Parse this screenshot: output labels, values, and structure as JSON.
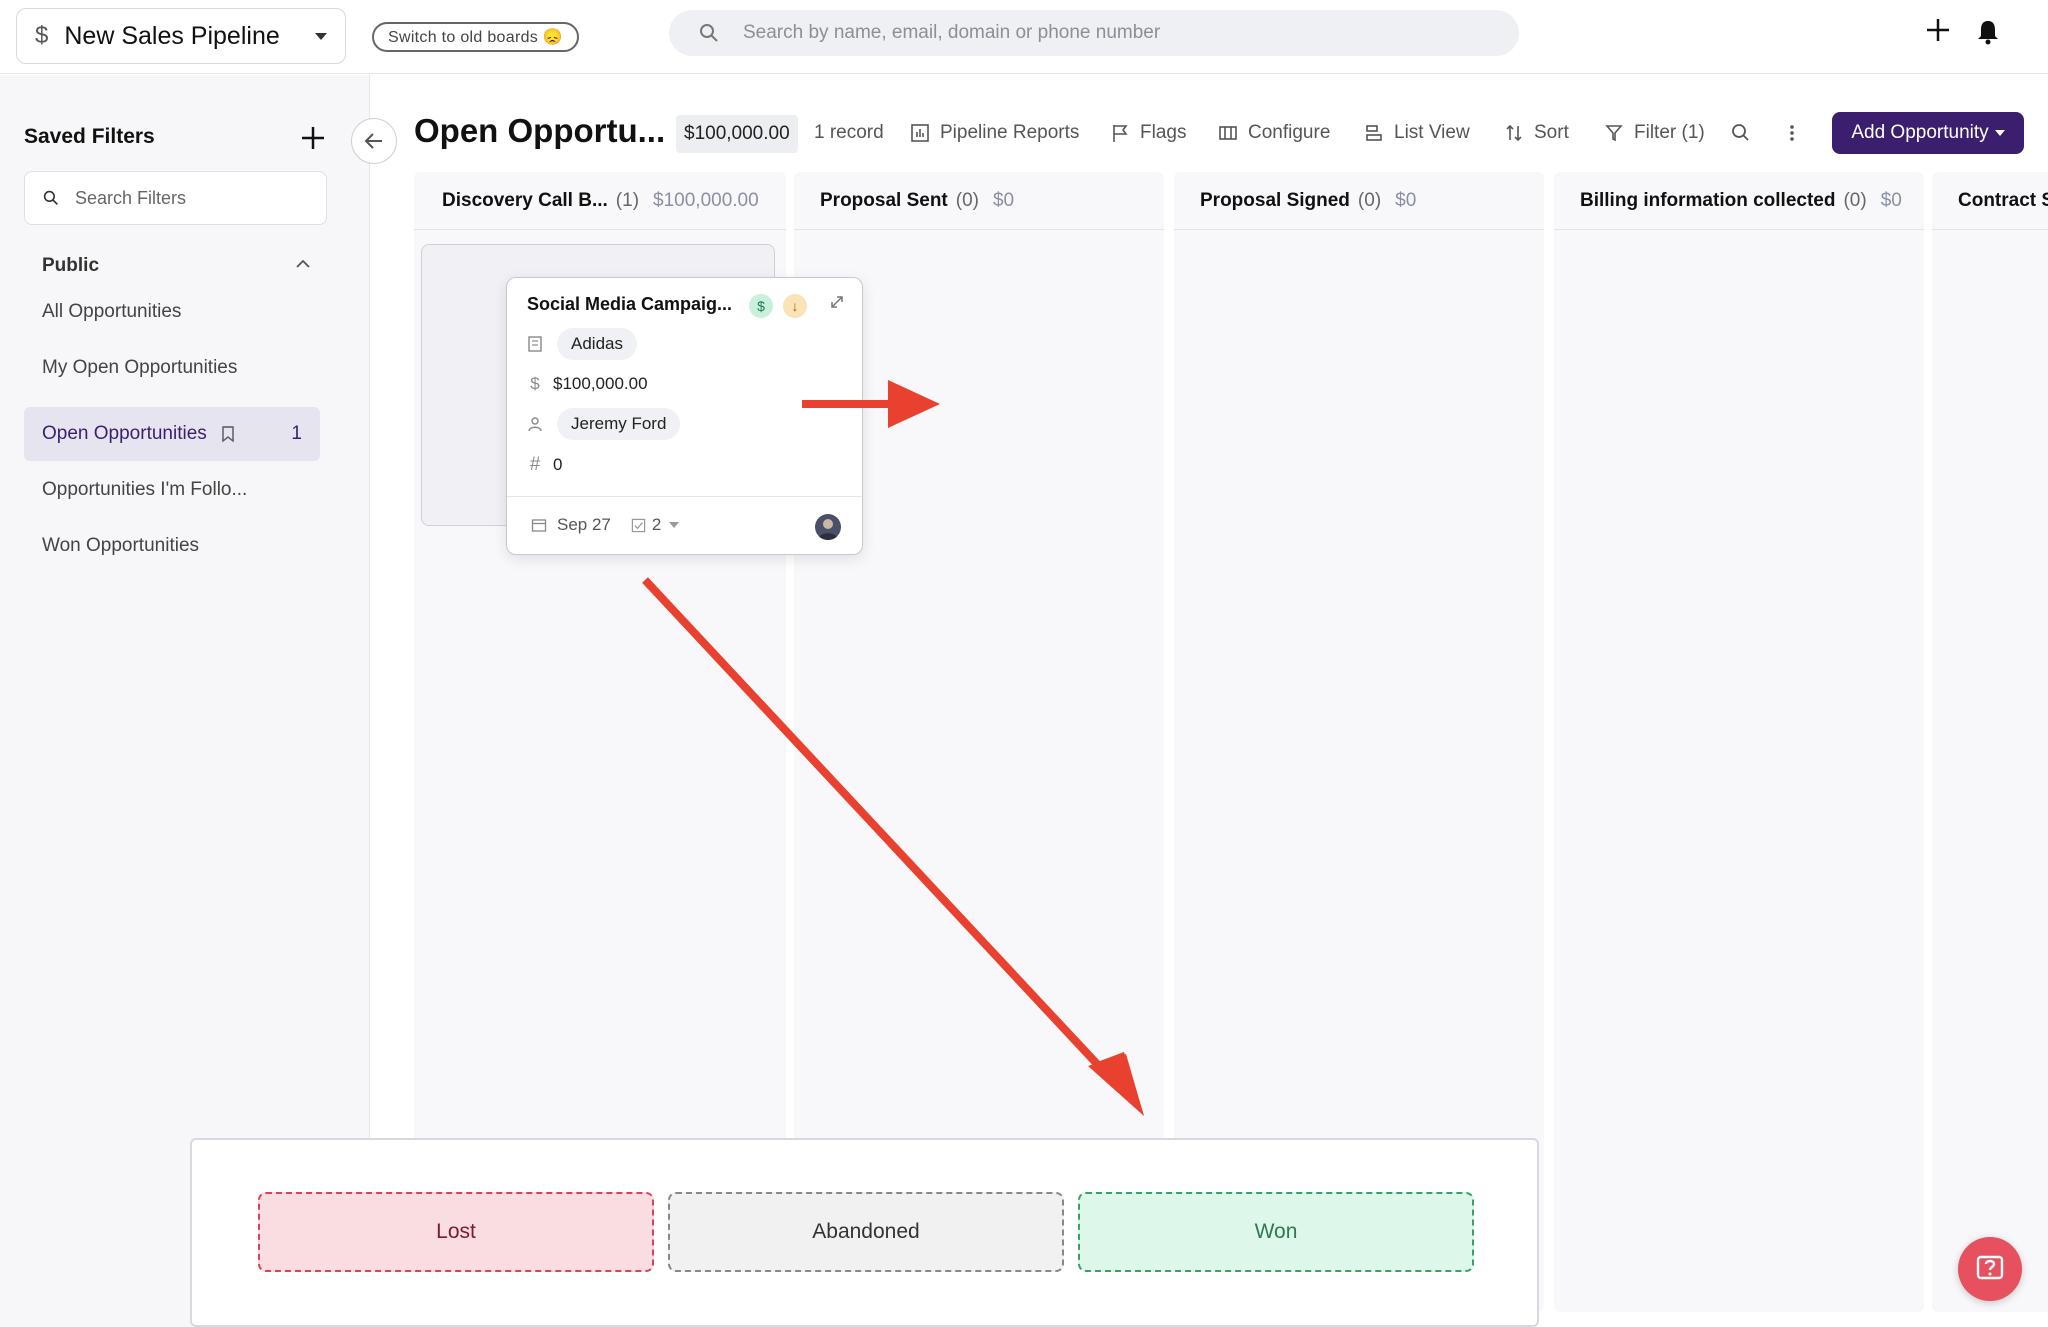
{
  "topbar": {
    "pipeline_name": "New Sales Pipeline",
    "switch_old_label": "Switch to old boards 😞",
    "search_placeholder": "Search by name, email, domain or phone number"
  },
  "sidebar": {
    "title": "Saved Filters",
    "search_placeholder": "Search Filters",
    "group_label": "Public",
    "items": [
      {
        "label": "All Opportunities"
      },
      {
        "label": "My Open Opportunities"
      },
      {
        "label": "Open Opportunities",
        "count": "1",
        "active": true
      },
      {
        "label": "Opportunities I'm Follo..."
      },
      {
        "label": "Won Opportunities"
      }
    ]
  },
  "header": {
    "title": "Open Opportu...",
    "total_amount": "$100,000.00",
    "record_count": "1 record",
    "toolbar": {
      "pipeline_reports": "Pipeline Reports",
      "flags": "Flags",
      "configure": "Configure",
      "list_view": "List View",
      "sort": "Sort",
      "filter": "Filter (1)",
      "add_opportunity": "Add Opportunity"
    }
  },
  "columns": [
    {
      "name": "Discovery Call B...",
      "count": "(1)",
      "amount": "$100,000.00"
    },
    {
      "name": "Proposal Sent",
      "count": "(0)",
      "amount": "$0"
    },
    {
      "name": "Proposal Signed",
      "count": "(0)",
      "amount": "$0"
    },
    {
      "name": "Billing information collected",
      "count": "(0)",
      "amount": "$0"
    },
    {
      "name": "Contract S",
      "count": "",
      "amount": ""
    }
  ],
  "card": {
    "title": "Social Media Campaig...",
    "company": "Adidas",
    "value": "$100,000.00",
    "owner": "Jeremy Ford",
    "number": "0",
    "date": "Sep 27",
    "tasks": "2"
  },
  "drop_zone": {
    "lost": "Lost",
    "abandoned": "Abandoned",
    "won": "Won"
  },
  "colors": {
    "accent": "#3b1f6e",
    "arrow": "#e8412f",
    "lost_bg": "#f9dde0",
    "won_bg": "#ddf8ea",
    "help": "#e6505f"
  }
}
